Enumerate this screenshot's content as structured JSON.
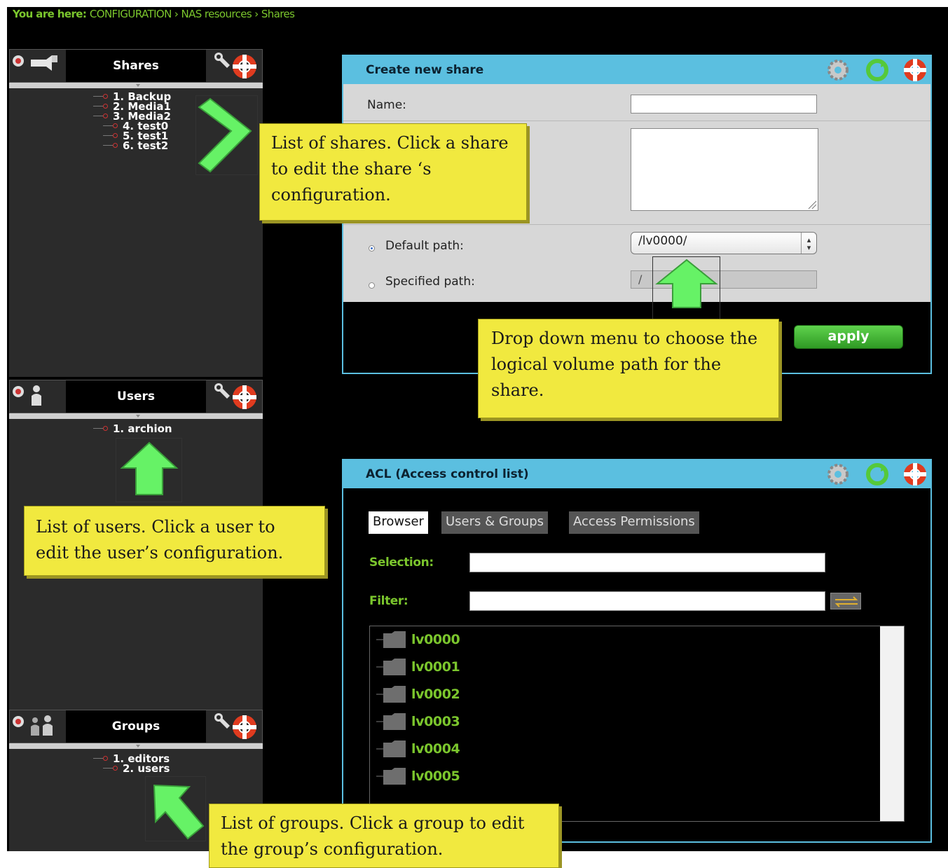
{
  "breadcrumb": {
    "prefix": "You are here:",
    "path": "CONFIGURATION › NAS resources › Shares"
  },
  "sidebar": {
    "shares": {
      "title": "Shares",
      "items": [
        "1. Backup",
        "2. Media1",
        "3. Media2",
        "4. test0",
        "5. test1",
        "6. test2"
      ]
    },
    "users": {
      "title": "Users",
      "items": [
        "1. archion"
      ]
    },
    "groups": {
      "title": "Groups",
      "items": [
        "1. editors",
        "2. users"
      ]
    }
  },
  "create_share": {
    "title": "Create new share",
    "name_label": "Name:",
    "name_value": "",
    "comment_value": "",
    "default_path_label": "Default path:",
    "default_path_value": "/lv0000/",
    "specified_path_label": "Specified path:",
    "specified_path_value": "/",
    "apply_label": "apply"
  },
  "acl": {
    "title": "ACL (Access control list)",
    "tabs": [
      "Browser",
      "Users & Groups",
      "Access Permissions"
    ],
    "selection_label": "Selection:",
    "selection_value": "",
    "filter_label": "Filter:",
    "filter_value": "",
    "volumes": [
      "lv0000",
      "lv0001",
      "lv0002",
      "lv0003",
      "lv0004",
      "lv0005"
    ]
  },
  "callouts": {
    "shares": "List of shares.  Click a share to edit the share ‘s configuration.",
    "path": "Drop down menu to choose the logical volume path for the share.",
    "users": "List of users.  Click a user to edit the user’s configuration.",
    "groups": "List of groups.  Click a group to edit the group’s configuration."
  },
  "colors": {
    "accent_blue": "#5bbfe0",
    "green_text": "#7bc62d",
    "callout_yellow": "#f1e93f",
    "arrow_green": "#66f266",
    "apply_green": "#3ab52c"
  },
  "icons": [
    "share-icon",
    "user-icon",
    "group-icon",
    "wrench-icon",
    "lifebuoy-icon",
    "gear-icon",
    "refresh-icon",
    "folder-icon",
    "filter-icon"
  ]
}
